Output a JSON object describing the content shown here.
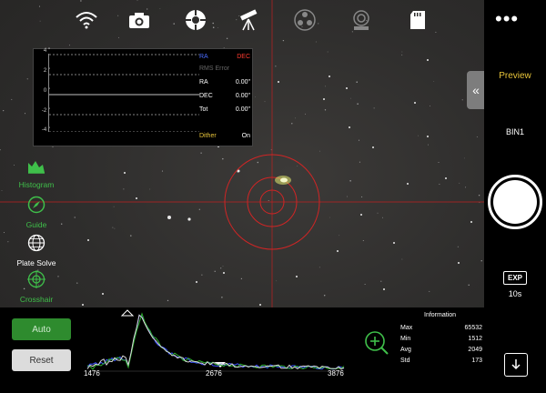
{
  "toolbar": {
    "icons": [
      "wifi-icon",
      "camera-icon",
      "focuser-icon",
      "telescope-icon",
      "filter-wheel-icon",
      "webcam-icon",
      "sd-card-icon"
    ]
  },
  "guide": {
    "y_ticks": [
      "4 \"",
      "2 \"",
      "0 \"",
      "-2 \"",
      "-4 \""
    ],
    "ra_label": "RA",
    "dec_label": "DEC",
    "rms_label": "RMS Error",
    "rows": [
      {
        "label": "RA",
        "value": "0.00\""
      },
      {
        "label": "DEC",
        "value": "0.00\""
      },
      {
        "label": "Tot",
        "value": "0.00\""
      }
    ],
    "dither_label": "Dither",
    "dither_value": "On",
    "colors": {
      "ra": "#4a6cff",
      "dec": "#ff3b30",
      "dither": "#e8c53a"
    }
  },
  "tools": [
    {
      "name": "histogram",
      "label": "Histogram",
      "color": "#3fbf4a"
    },
    {
      "name": "guide",
      "label": "Guide",
      "color": "#3fbf4a"
    },
    {
      "name": "plate-solve",
      "label": "Plate Solve",
      "color": "#ffffff"
    },
    {
      "name": "crosshair",
      "label": "Crosshair",
      "color": "#3fbf4a"
    }
  ],
  "right": {
    "more": "•••",
    "preview": "Preview",
    "bin": "BIN1",
    "exp_label": "EXP",
    "exp_value": "10s"
  },
  "bottom": {
    "auto": "Auto",
    "reset": "Reset",
    "histogram": {
      "min_label": "1476",
      "mid_label": "2676",
      "max_label": "3876"
    },
    "info": {
      "title": "Information",
      "rows": [
        {
          "label": "Max",
          "value": "65532"
        },
        {
          "label": "Min",
          "value": "1512"
        },
        {
          "label": "Avg",
          "value": "2049"
        },
        {
          "label": "Std",
          "value": "173"
        }
      ]
    }
  }
}
